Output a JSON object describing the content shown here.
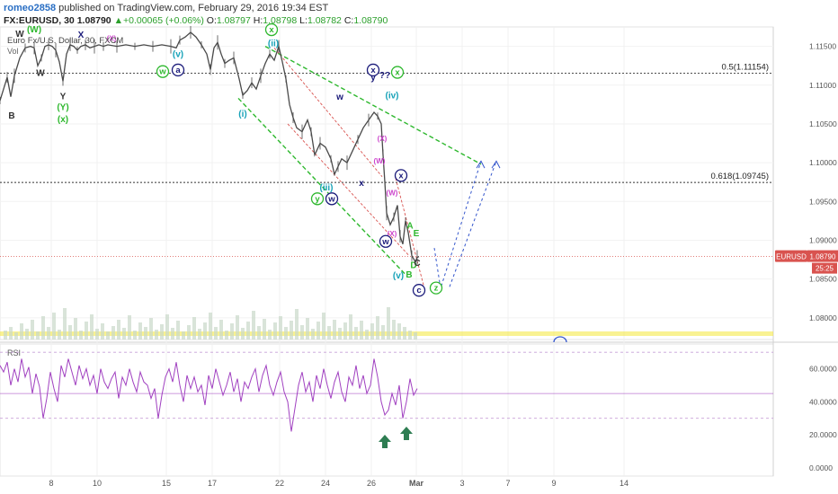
{
  "header": {
    "username": "romeo2858",
    "published_text": "published on TradingView.com, February 29, 2016 19:34 EST",
    "symbol": "FX:EURUSD, 30",
    "last_price": "1.08790",
    "change": "▲+0.00065 (+0.06%)",
    "o_label": "O:",
    "o": "1.08797",
    "h_label": "H:",
    "h": "1.08798",
    "l_label": "L:",
    "l": "1.08782",
    "c_label": "C:",
    "c": "1.08790"
  },
  "pane_title": "Euro Fx/U.S. Dollar, 30, FXCM",
  "vol_label": "Vol",
  "rsi_label": "RSI",
  "symbol_tag": "EURUSD",
  "price_tag": "1.08790",
  "countdown_tag": "25:25",
  "colors": {
    "candle": "#4a4a4a",
    "fib": "#333333",
    "green": "#2eb82e",
    "navy": "#1a1a7a",
    "teal": "#17a2b8",
    "magenta": "#cc44cc",
    "red": "#d9534f",
    "blue": "#3355cc",
    "rsi": "#a040c0",
    "arrow": "#2e7d52",
    "yellow": "#f5e94a"
  },
  "chart_data": {
    "type": "line",
    "price_axis": {
      "range": [
        1.0772,
        1.1175
      ],
      "ticks": [
        "1.11500",
        "1.11000",
        "1.10500",
        "1.10000",
        "1.09500",
        "1.09000",
        "1.08500",
        "1.08000"
      ]
    },
    "rsi_axis": {
      "range": [
        -5,
        75
      ],
      "ticks": [
        "60.0000",
        "40.0000",
        "20.0000",
        "0.0000"
      ],
      "levels": [
        70,
        30
      ]
    },
    "x_ticks": [
      "8",
      "10",
      "15",
      "17",
      "22",
      "24",
      "26",
      "Mar",
      "3",
      "7",
      "9",
      "14"
    ],
    "fib_levels": [
      {
        "label": "0.5(1.11154)",
        "price": 1.11154
      },
      {
        "label": "0.618(1.09745)",
        "price": 1.09745
      }
    ],
    "last_price": 1.0879,
    "price_series": [
      [
        0,
        1.108
      ],
      [
        4,
        1.1095
      ],
      [
        8,
        1.111
      ],
      [
        12,
        1.1085
      ],
      [
        16,
        1.1112
      ],
      [
        22,
        1.1135
      ],
      [
        28,
        1.1148
      ],
      [
        34,
        1.115
      ],
      [
        38,
        1.1148
      ],
      [
        42,
        1.1125
      ],
      [
        46,
        1.1135
      ],
      [
        50,
        1.115
      ],
      [
        54,
        1.1152
      ],
      [
        58,
        1.115
      ],
      [
        62,
        1.1145
      ],
      [
        66,
        1.113
      ],
      [
        70,
        1.1105
      ],
      [
        74,
        1.114
      ],
      [
        78,
        1.1152
      ],
      [
        82,
        1.115
      ],
      [
        86,
        1.1145
      ],
      [
        90,
        1.115
      ],
      [
        95,
        1.1152
      ],
      [
        100,
        1.1148
      ],
      [
        105,
        1.115
      ],
      [
        110,
        1.1152
      ],
      [
        115,
        1.115
      ],
      [
        120,
        1.1152
      ],
      [
        130,
        1.115
      ],
      [
        140,
        1.1152
      ],
      [
        150,
        1.115
      ],
      [
        160,
        1.1152
      ],
      [
        170,
        1.115
      ],
      [
        180,
        1.1152
      ],
      [
        190,
        1.115
      ],
      [
        196,
        1.1148
      ],
      [
        200,
        1.1158
      ],
      [
        206,
        1.1162
      ],
      [
        212,
        1.1168
      ],
      [
        218,
        1.1162
      ],
      [
        224,
        1.1152
      ],
      [
        230,
        1.114
      ],
      [
        234,
        1.112
      ],
      [
        238,
        1.1148
      ],
      [
        242,
        1.1155
      ],
      [
        246,
        1.114
      ],
      [
        250,
        1.1128
      ],
      [
        255,
        1.1132
      ],
      [
        260,
        1.1135
      ],
      [
        266,
        1.1108
      ],
      [
        270,
        1.1087
      ],
      [
        275,
        1.1093
      ],
      [
        280,
        1.1103
      ],
      [
        285,
        1.1095
      ],
      [
        290,
        1.1112
      ],
      [
        295,
        1.1128
      ],
      [
        300,
        1.114
      ],
      [
        305,
        1.1132
      ],
      [
        310,
        1.115
      ],
      [
        314,
        1.113
      ],
      [
        318,
        1.1108
      ],
      [
        322,
        1.1075
      ],
      [
        326,
        1.1058
      ],
      [
        330,
        1.1045
      ],
      [
        336,
        1.104
      ],
      [
        342,
        1.1055
      ],
      [
        346,
        1.104
      ],
      [
        350,
        1.101
      ],
      [
        356,
        1.1025
      ],
      [
        362,
        1.102
      ],
      [
        368,
        1.1005
      ],
      [
        372,
        1.0985
      ],
      [
        376,
        1.0995
      ],
      [
        380,
        1.1005
      ],
      [
        386,
        1.1
      ],
      [
        392,
        1.1015
      ],
      [
        398,
        1.103
      ],
      [
        404,
        1.1045
      ],
      [
        410,
        1.1055
      ],
      [
        416,
        1.1065
      ],
      [
        420,
        1.106
      ],
      [
        424,
        1.105
      ],
      [
        426,
        1.101
      ],
      [
        428,
        1.0975
      ],
      [
        430,
        1.0935
      ],
      [
        434,
        1.092
      ],
      [
        438,
        1.093
      ],
      [
        442,
        1.0945
      ],
      [
        445,
        1.0905
      ],
      [
        448,
        1.0895
      ],
      [
        451,
        1.0925
      ],
      [
        454,
        1.091
      ],
      [
        458,
        1.088
      ],
      [
        462,
        1.0872
      ],
      [
        464,
        1.0878
      ],
      [
        466,
        1.0879
      ]
    ],
    "rsi_series": [
      [
        0,
        62
      ],
      [
        4,
        58
      ],
      [
        8,
        64
      ],
      [
        12,
        50
      ],
      [
        16,
        60
      ],
      [
        20,
        52
      ],
      [
        24,
        66
      ],
      [
        28,
        55
      ],
      [
        32,
        61
      ],
      [
        36,
        45
      ],
      [
        40,
        57
      ],
      [
        44,
        49
      ],
      [
        48,
        30
      ],
      [
        52,
        42
      ],
      [
        56,
        58
      ],
      [
        60,
        48
      ],
      [
        64,
        40
      ],
      [
        68,
        62
      ],
      [
        72,
        55
      ],
      [
        76,
        66
      ],
      [
        80,
        58
      ],
      [
        84,
        50
      ],
      [
        88,
        62
      ],
      [
        92,
        54
      ],
      [
        96,
        60
      ],
      [
        100,
        50
      ],
      [
        104,
        56
      ],
      [
        108,
        45
      ],
      [
        112,
        60
      ],
      [
        116,
        52
      ],
      [
        120,
        48
      ],
      [
        124,
        54
      ],
      [
        128,
        58
      ],
      [
        132,
        42
      ],
      [
        136,
        55
      ],
      [
        140,
        50
      ],
      [
        144,
        60
      ],
      [
        148,
        52
      ],
      [
        152,
        46
      ],
      [
        156,
        58
      ],
      [
        160,
        52
      ],
      [
        164,
        50
      ],
      [
        168,
        42
      ],
      [
        172,
        48
      ],
      [
        176,
        30
      ],
      [
        180,
        44
      ],
      [
        184,
        55
      ],
      [
        188,
        60
      ],
      [
        192,
        52
      ],
      [
        196,
        64
      ],
      [
        200,
        50
      ],
      [
        204,
        40
      ],
      [
        208,
        56
      ],
      [
        212,
        48
      ],
      [
        216,
        55
      ],
      [
        220,
        46
      ],
      [
        224,
        50
      ],
      [
        228,
        38
      ],
      [
        232,
        56
      ],
      [
        236,
        48
      ],
      [
        240,
        60
      ],
      [
        244,
        52
      ],
      [
        248,
        44
      ],
      [
        252,
        50
      ],
      [
        256,
        58
      ],
      [
        260,
        46
      ],
      [
        264,
        54
      ],
      [
        268,
        40
      ],
      [
        272,
        52
      ],
      [
        276,
        48
      ],
      [
        280,
        55
      ],
      [
        284,
        60
      ],
      [
        288,
        46
      ],
      [
        292,
        56
      ],
      [
        296,
        62
      ],
      [
        300,
        50
      ],
      [
        304,
        44
      ],
      [
        308,
        52
      ],
      [
        312,
        58
      ],
      [
        316,
        46
      ],
      [
        320,
        40
      ],
      [
        324,
        22
      ],
      [
        328,
        36
      ],
      [
        332,
        50
      ],
      [
        336,
        58
      ],
      [
        340,
        46
      ],
      [
        344,
        52
      ],
      [
        348,
        40
      ],
      [
        352,
        56
      ],
      [
        356,
        48
      ],
      [
        360,
        60
      ],
      [
        364,
        50
      ],
      [
        368,
        42
      ],
      [
        372,
        52
      ],
      [
        376,
        58
      ],
      [
        380,
        46
      ],
      [
        384,
        40
      ],
      [
        388,
        55
      ],
      [
        392,
        50
      ],
      [
        396,
        62
      ],
      [
        400,
        48
      ],
      [
        404,
        56
      ],
      [
        408,
        45
      ],
      [
        412,
        50
      ],
      [
        416,
        66
      ],
      [
        420,
        55
      ],
      [
        424,
        40
      ],
      [
        428,
        32
      ],
      [
        432,
        35
      ],
      [
        436,
        45
      ],
      [
        440,
        38
      ],
      [
        444,
        50
      ],
      [
        448,
        30
      ],
      [
        452,
        40
      ],
      [
        456,
        54
      ],
      [
        460,
        44
      ],
      [
        464,
        48
      ]
    ],
    "volume_series": [
      [
        4,
        10
      ],
      [
        10,
        14
      ],
      [
        16,
        8
      ],
      [
        22,
        18
      ],
      [
        28,
        12
      ],
      [
        34,
        22
      ],
      [
        40,
        9
      ],
      [
        46,
        26
      ],
      [
        52,
        14
      ],
      [
        58,
        30
      ],
      [
        64,
        11
      ],
      [
        70,
        35
      ],
      [
        76,
        16
      ],
      [
        82,
        24
      ],
      [
        88,
        10
      ],
      [
        94,
        20
      ],
      [
        100,
        28
      ],
      [
        106,
        12
      ],
      [
        112,
        18
      ],
      [
        118,
        9
      ],
      [
        124,
        15
      ],
      [
        130,
        22
      ],
      [
        136,
        13
      ],
      [
        142,
        27
      ],
      [
        148,
        10
      ],
      [
        154,
        19
      ],
      [
        160,
        14
      ],
      [
        166,
        24
      ],
      [
        172,
        11
      ],
      [
        178,
        17
      ],
      [
        184,
        28
      ],
      [
        190,
        13
      ],
      [
        196,
        21
      ],
      [
        202,
        9
      ],
      [
        208,
        16
      ],
      [
        214,
        25
      ],
      [
        220,
        12
      ],
      [
        226,
        19
      ],
      [
        232,
        30
      ],
      [
        238,
        14
      ],
      [
        244,
        22
      ],
      [
        250,
        10
      ],
      [
        256,
        18
      ],
      [
        262,
        27
      ],
      [
        268,
        13
      ],
      [
        274,
        20
      ],
      [
        280,
        32
      ],
      [
        286,
        15
      ],
      [
        292,
        23
      ],
      [
        298,
        11
      ],
      [
        304,
        19
      ],
      [
        310,
        26
      ],
      [
        316,
        14
      ],
      [
        322,
        21
      ],
      [
        328,
        34
      ],
      [
        334,
        16
      ],
      [
        340,
        24
      ],
      [
        346,
        12
      ],
      [
        352,
        20
      ],
      [
        358,
        30
      ],
      [
        364,
        15
      ],
      [
        370,
        22
      ],
      [
        376,
        13
      ],
      [
        382,
        19
      ],
      [
        388,
        28
      ],
      [
        394,
        14
      ],
      [
        400,
        21
      ],
      [
        406,
        11
      ],
      [
        412,
        18
      ],
      [
        418,
        26
      ],
      [
        424,
        16
      ],
      [
        430,
        36
      ],
      [
        436,
        22
      ],
      [
        442,
        18
      ],
      [
        448,
        14
      ],
      [
        454,
        10
      ],
      [
        460,
        8
      ]
    ],
    "wave_labels": [
      {
        "t": "(x)",
        "x": 70,
        "y": 1.1052,
        "c": "green"
      },
      {
        "t": "(Y)",
        "x": 70,
        "y": 1.1068,
        "c": "green"
      },
      {
        "t": "Y",
        "x": 70,
        "y": 1.1082,
        "c": "dark"
      },
      {
        "t": "W",
        "x": 45,
        "y": 1.1112,
        "c": "dark"
      },
      {
        "t": "B",
        "x": 13,
        "y": 1.1057,
        "c": "dark"
      },
      {
        "t": "W",
        "x": 22,
        "y": 1.1162,
        "c": "dark"
      },
      {
        "t": "X",
        "x": 90,
        "y": 1.1161,
        "c": "navy"
      },
      {
        "t": "(X)",
        "x": 124,
        "y": 1.1157,
        "c": "magenta"
      },
      {
        "t": "(W)",
        "x": 38,
        "y": 1.1168,
        "c": "green"
      },
      {
        "t": "(v)",
        "x": 198,
        "y": 1.1136,
        "c": "teal"
      },
      {
        "t": "(i)",
        "x": 270,
        "y": 1.1059,
        "c": "teal"
      },
      {
        "t": "(ii)",
        "x": 304,
        "y": 1.115,
        "c": "teal"
      },
      {
        "t": "(iii)",
        "x": 363,
        "y": 1.0964,
        "c": "teal"
      },
      {
        "t": "(iv)",
        "x": 436,
        "y": 1.1083,
        "c": "teal"
      },
      {
        "t": "(v)",
        "x": 443,
        "y": 1.0851,
        "c": "teal"
      },
      {
        "t": "w",
        "x": 378,
        "y": 1.1081,
        "c": "navy"
      },
      {
        "t": "x",
        "x": 402,
        "y": 1.097,
        "c": "navy"
      },
      {
        "t": "y",
        "x": 415,
        "y": 1.1106,
        "c": "navy"
      },
      {
        "t": "??",
        "x": 428,
        "y": 1.1109,
        "c": "navy"
      },
      {
        "t": "(X)",
        "x": 425,
        "y": 1.1028,
        "c": "magenta"
      },
      {
        "t": "(W)",
        "x": 422,
        "y": 1.0999,
        "c": "magenta"
      },
      {
        "t": "(W)",
        "x": 436,
        "y": 1.0958,
        "c": "magenta"
      },
      {
        "t": "(X)",
        "x": 436,
        "y": 1.0905,
        "c": "magenta"
      },
      {
        "t": "A",
        "x": 456,
        "y": 1.0915,
        "c": "green"
      },
      {
        "t": "E",
        "x": 463,
        "y": 1.0905,
        "c": "green"
      },
      {
        "t": "D",
        "x": 460,
        "y": 1.0864,
        "c": "green"
      },
      {
        "t": "B",
        "x": 455,
        "y": 1.0852,
        "c": "green"
      },
      {
        "t": "C",
        "x": 464,
        "y": 1.0867,
        "c": "dark"
      }
    ],
    "circled_labels": [
      {
        "t": "x",
        "x": 302,
        "y": 1.1168,
        "c": "green"
      },
      {
        "t": "w",
        "x": 181,
        "y": 1.1114,
        "c": "green"
      },
      {
        "t": "a",
        "x": 198,
        "y": 1.1116,
        "c": "navy"
      },
      {
        "t": "x",
        "x": 415,
        "y": 1.1116,
        "c": "navy"
      },
      {
        "t": "x",
        "x": 442,
        "y": 1.1113,
        "c": "green"
      },
      {
        "t": "y",
        "x": 353,
        "y": 1.095,
        "c": "green"
      },
      {
        "t": "w",
        "x": 369,
        "y": 1.095,
        "c": "navy"
      },
      {
        "t": "w",
        "x": 429,
        "y": 1.0895,
        "c": "navy"
      },
      {
        "t": "x",
        "x": 446,
        "y": 1.098,
        "c": "navy"
      },
      {
        "t": "z",
        "x": 485,
        "y": 1.0835,
        "c": "green"
      },
      {
        "t": "c",
        "x": 466,
        "y": 1.0832,
        "c": "navy"
      }
    ]
  }
}
